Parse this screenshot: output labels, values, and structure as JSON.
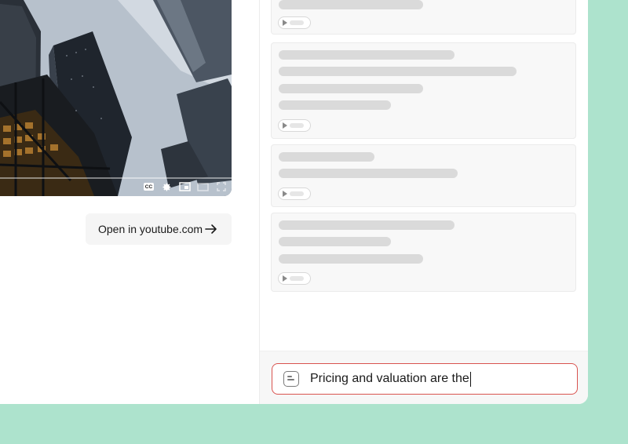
{
  "video": {
    "controls": [
      "cc-icon",
      "gear-icon",
      "miniplayer-icon",
      "theater-icon",
      "fullscreen-icon"
    ],
    "cc_label": "CC"
  },
  "open_youtube": {
    "label": "Open in youtube.com",
    "icon": "arrow-right-icon"
  },
  "transcript": {
    "segments": [
      {
        "lines": 1,
        "has_play": true
      },
      {
        "lines": 4,
        "has_play": true
      },
      {
        "lines": 2,
        "has_play": true
      },
      {
        "lines": 3,
        "has_play": true
      }
    ]
  },
  "composer": {
    "value": "Pricing and valuation are the",
    "icon": "note-icon",
    "accent_color": "#d9534f"
  },
  "colors": {
    "backdrop": "#ade3cd",
    "skeleton": "#dadada"
  }
}
